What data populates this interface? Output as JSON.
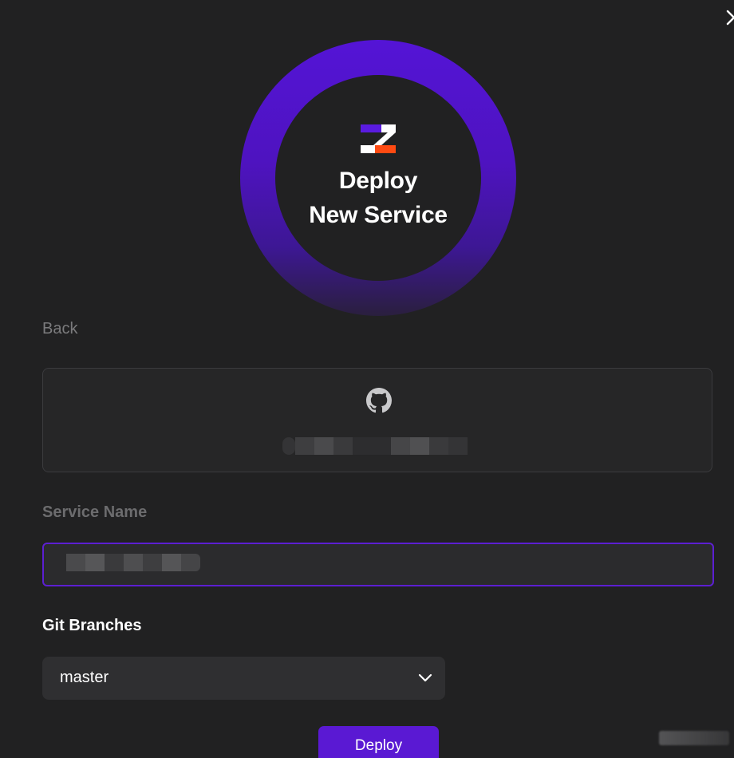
{
  "dialog": {
    "close_glyph": "×"
  },
  "hero": {
    "title_line1": "Deploy",
    "title_line2": "New Service",
    "logo_icon": "brand-logo-icon",
    "ring_colors": {
      "top": "#5414d6",
      "bottom": "#2a1f3e"
    }
  },
  "nav": {
    "back_label": "Back"
  },
  "repository": {
    "icon": "github-icon",
    "name_redacted": true
  },
  "form": {
    "service_name": {
      "label": "Service Name",
      "value_redacted": true
    },
    "git_branches": {
      "label": "Git Branches",
      "selected": "master"
    },
    "submit_label": "Deploy"
  },
  "colors": {
    "accent": "#5a19d3",
    "background": "#212122",
    "logo_purple": "#5a1be0",
    "logo_orange": "#ff4a12"
  }
}
